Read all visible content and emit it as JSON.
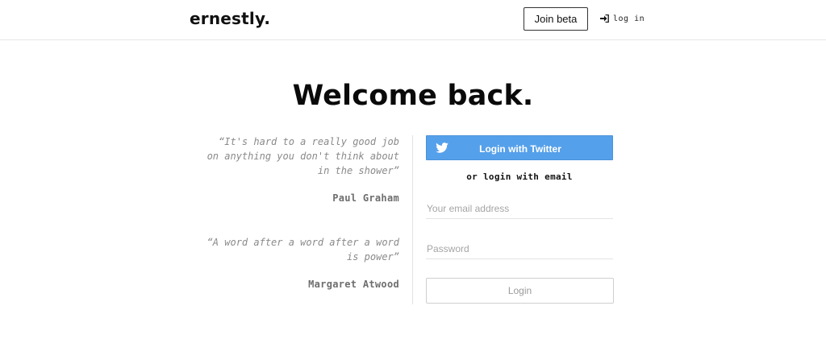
{
  "header": {
    "logo": "ernestly.",
    "join_beta_label": "Join beta",
    "login_label": "log in",
    "login_icon": "sign-in-icon"
  },
  "main": {
    "headline": "Welcome back.",
    "quotes": [
      {
        "text": "“It's hard to a really good job on anything you don't think about in the shower”",
        "author": "Paul Graham"
      },
      {
        "text": "“A word after a word after a word is power”",
        "author": "Margaret Atwood"
      }
    ],
    "login_form": {
      "twitter_button_label": "Login with Twitter",
      "twitter_icon": "twitter-bird-icon",
      "or_email_text": "or login with email",
      "email_placeholder": "Your email address",
      "email_value": "",
      "password_placeholder": "Password",
      "password_value": "",
      "login_button_label": "Login"
    }
  },
  "colors": {
    "twitter_blue": "#55a0ea",
    "text_dark": "#111111",
    "quote_gray": "#8a8a8a",
    "divider": "#e2e2e2"
  }
}
